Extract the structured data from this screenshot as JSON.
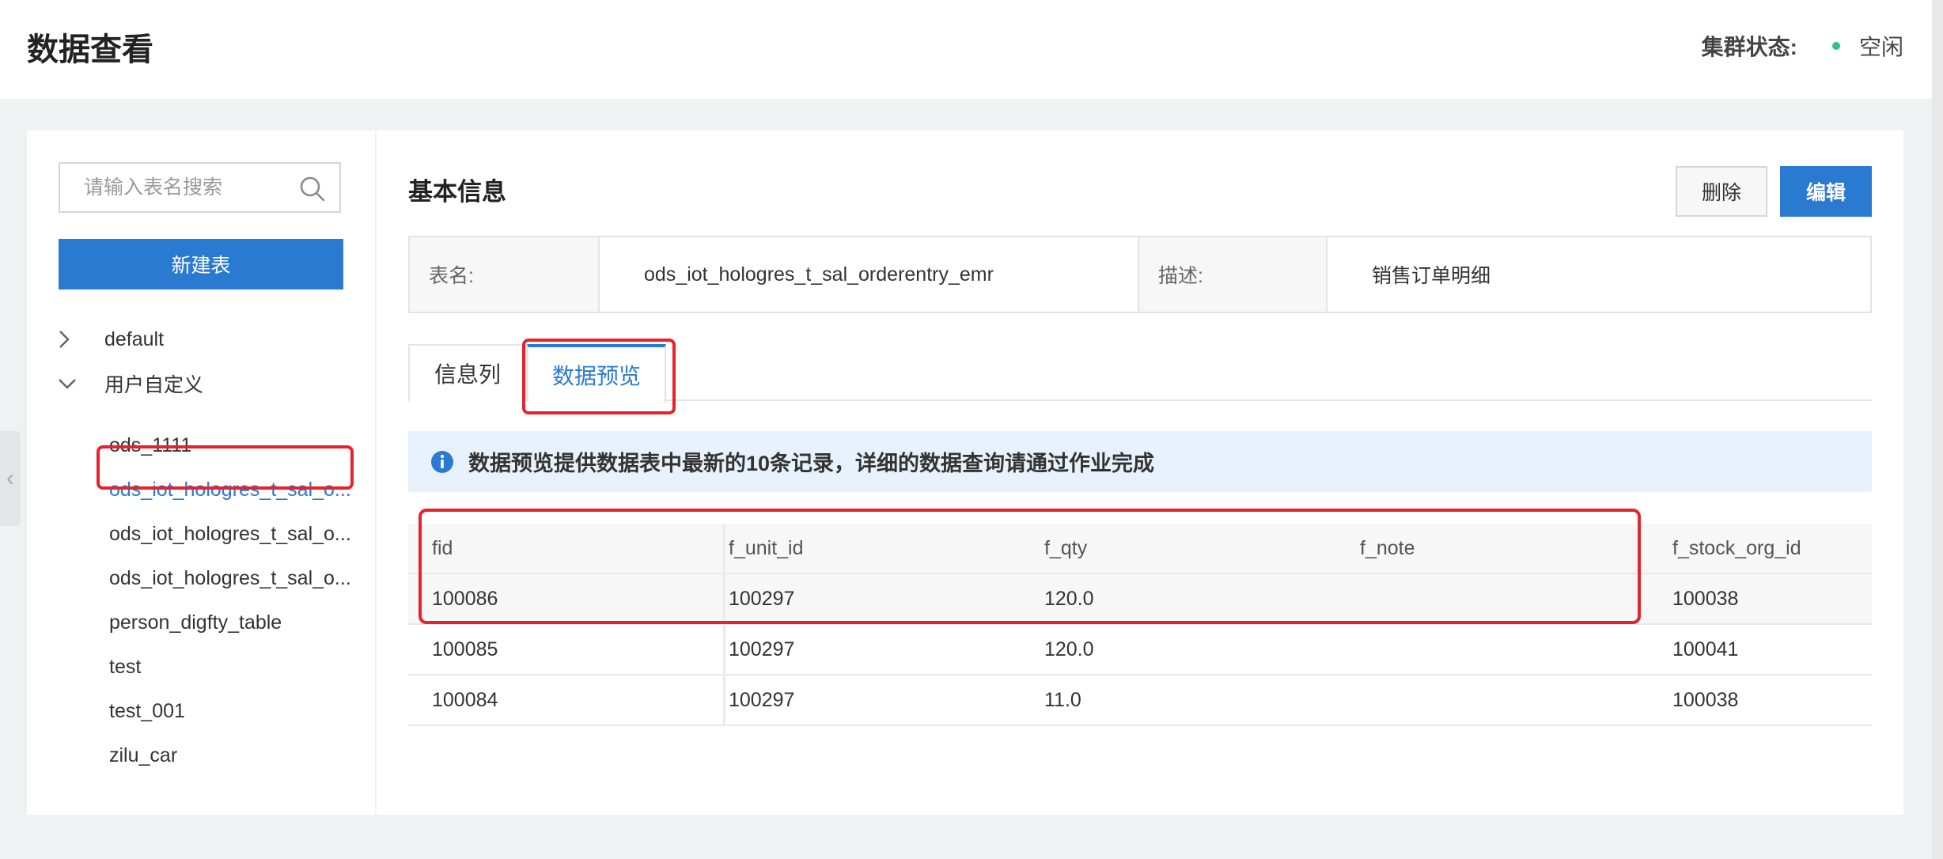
{
  "header": {
    "title": "数据查看",
    "cluster_label": "集群状态:",
    "cluster_status": "空闲",
    "cluster_status_color": "#2fbf8a"
  },
  "sidebar": {
    "search_placeholder": "请输入表名搜索",
    "new_table_label": "新建表",
    "groups": [
      {
        "label": "default",
        "expanded": false
      },
      {
        "label": "用户自定义",
        "expanded": true
      }
    ],
    "tables": [
      "ods_1111",
      "ods_iot_hologres_t_sal_o...",
      "ods_iot_hologres_t_sal_o...",
      "ods_iot_hologres_t_sal_o...",
      "person_digfty_table",
      "test",
      "test_001",
      "zilu_car"
    ],
    "selected_index": 1
  },
  "main": {
    "section_title": "基本信息",
    "delete_label": "删除",
    "edit_label": "编辑",
    "info": {
      "name_key": "表名:",
      "name_value": "ods_iot_hologres_t_sal_orderentry_emr",
      "desc_key": "描述:",
      "desc_value": "销售订单明细"
    },
    "tabs": [
      {
        "label": "信息列",
        "active": false
      },
      {
        "label": "数据预览",
        "active": true
      }
    ],
    "notice": "数据预览提供数据表中最新的10条记录，详细的数据查询请通过作业完成",
    "table": {
      "columns": [
        "fid",
        "f_unit_id",
        "f_qty",
        "f_note",
        "f_stock_org_id"
      ],
      "rows": [
        [
          "100086",
          "100297",
          "120.0",
          "",
          "100038"
        ],
        [
          "100085",
          "100297",
          "120.0",
          "",
          "100041"
        ],
        [
          "100084",
          "100297",
          "11.0",
          "",
          "100038"
        ]
      ]
    }
  },
  "colors": {
    "primary": "#2a7ad2",
    "annotation": "#e5222d",
    "notice_bg": "#e7f2fc"
  }
}
